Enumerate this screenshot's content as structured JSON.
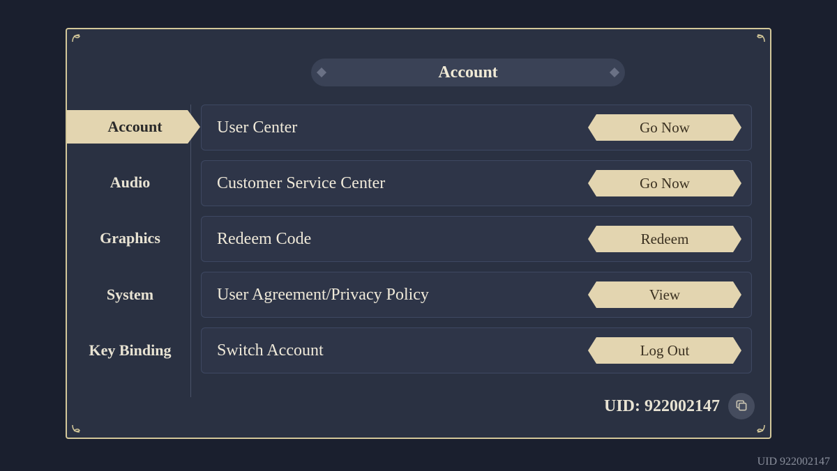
{
  "header": {
    "title": "Account"
  },
  "sidebar": {
    "items": [
      {
        "label": "Account",
        "active": true
      },
      {
        "label": "Audio",
        "active": false
      },
      {
        "label": "Graphics",
        "active": false
      },
      {
        "label": "System",
        "active": false
      },
      {
        "label": "Key Binding",
        "active": false
      }
    ]
  },
  "rows": [
    {
      "label": "User Center",
      "button": "Go Now"
    },
    {
      "label": "Customer Service Center",
      "button": "Go Now"
    },
    {
      "label": "Redeem Code",
      "button": "Redeem"
    },
    {
      "label": "User Agreement/Privacy Policy",
      "button": "View"
    },
    {
      "label": "Switch Account",
      "button": "Log Out"
    }
  ],
  "uid": {
    "prefix": "UID: ",
    "value": "922002147"
  },
  "watermark": "UID 922002147"
}
